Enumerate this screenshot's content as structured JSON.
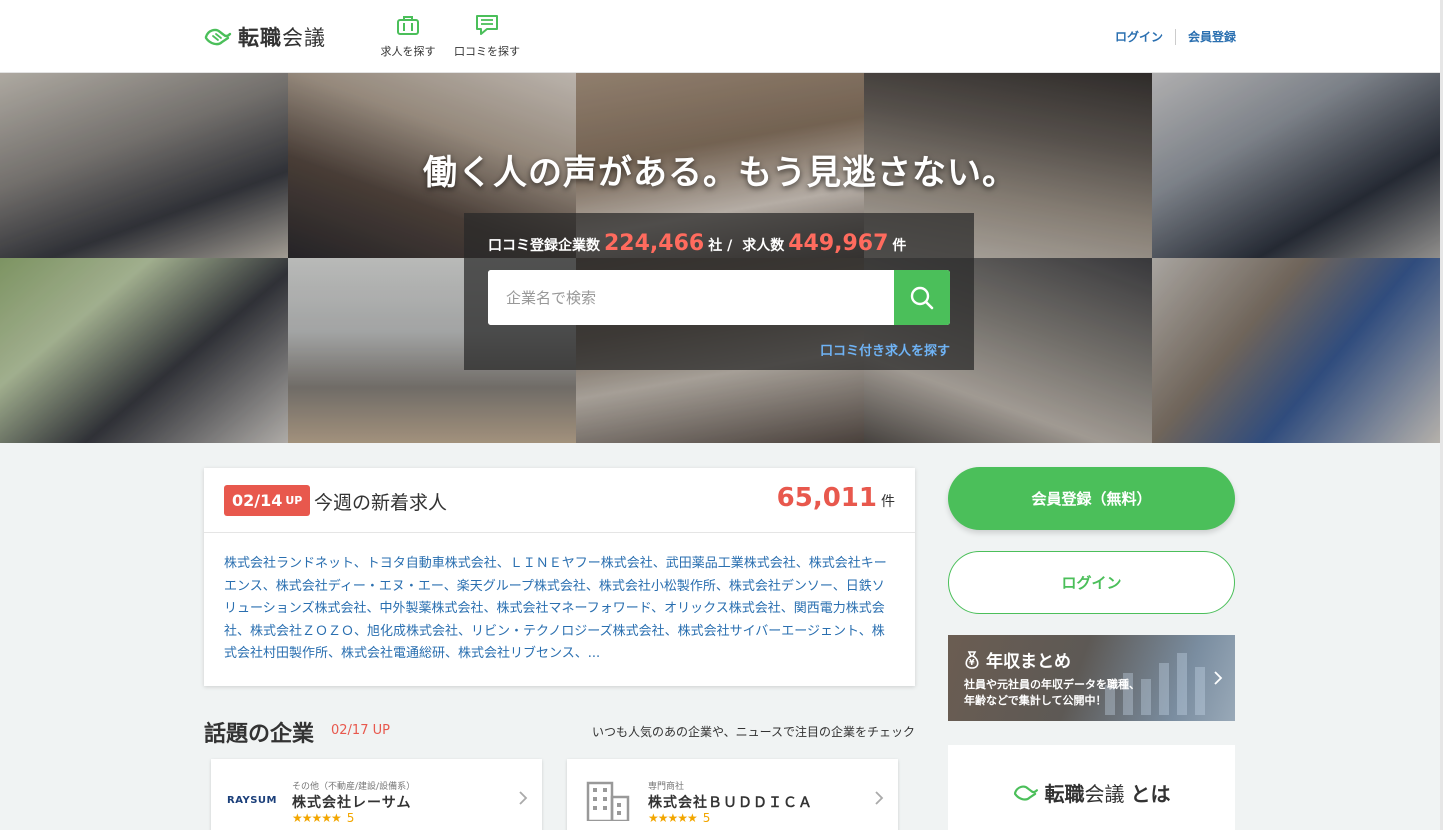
{
  "header": {
    "logo": {
      "part1": "転職",
      "part2": "会議"
    },
    "nav": [
      {
        "label": "求人を探す",
        "icon": "briefcase-icon"
      },
      {
        "label": "口コミを探す",
        "icon": "speech-bubble-icon"
      }
    ],
    "login": "ログイン",
    "register": "会員登録"
  },
  "hero": {
    "headline": "働く人の声がある。もう見逃さない。",
    "stats": {
      "companies_label": "口コミ登録企業数",
      "companies_count": "224,466",
      "companies_unit": "社 /",
      "jobs_label": "求人数",
      "jobs_count": "449,967",
      "jobs_unit": "件"
    },
    "search_placeholder": "企業名で検索",
    "review_jobs_link": "口コミ付き求人を探す"
  },
  "new_jobs": {
    "date": "02/14",
    "date_suffix": "UP",
    "title": "今週の新着求人",
    "count": "65,011",
    "count_unit": "件",
    "companies": "株式会社ランドネット、トヨタ自動車株式会社、ＬＩＮＥヤフー株式会社、武田薬品工業株式会社、株式会社キーエンス、株式会社ディー・エヌ・エー、楽天グループ株式会社、株式会社小松製作所、株式会社デンソー、日鉄ソリューションズ株式会社、中外製薬株式会社、株式会社マネーフォワード、オリックス株式会社、関西電力株式会社、株式会社ＺＯＺＯ、旭化成株式会社、リビン・テクノロジーズ株式会社、株式会社サイバーエージェント、株式会社村田製作所、株式会社電通総研、株式会社リブセンス、..."
  },
  "trending": {
    "title": "話題の企業",
    "date": "02/17 UP",
    "note": "いつも人気のあの企業や、ニュースで注目の企業をチェック",
    "cards": [
      {
        "logo_text": "RAYSUM",
        "category": "その他（不動産/建設/設備系）",
        "name": "株式会社レーサム",
        "stars": "★★★★★",
        "rating": "5"
      },
      {
        "logo_text": "",
        "category": "専門商社",
        "name": "株式会社ＢＵＤＤＩＣＡ",
        "stars": "★★★★★",
        "rating": "5"
      }
    ]
  },
  "sidebar": {
    "register_button": "会員登録（無料）",
    "login_button": "ログイン",
    "salary": {
      "title": "年収まとめ",
      "text_line1": "社員や元社員の年収データを職種、",
      "text_line2": "年齢などで集計して公開中！"
    },
    "about": {
      "part1": "転職",
      "part2": "会議",
      "suffix": "とは"
    }
  },
  "colors": {
    "brand_green": "#4bbf5a",
    "accent_red": "#e8584d",
    "link_blue": "#2a6fb0"
  }
}
